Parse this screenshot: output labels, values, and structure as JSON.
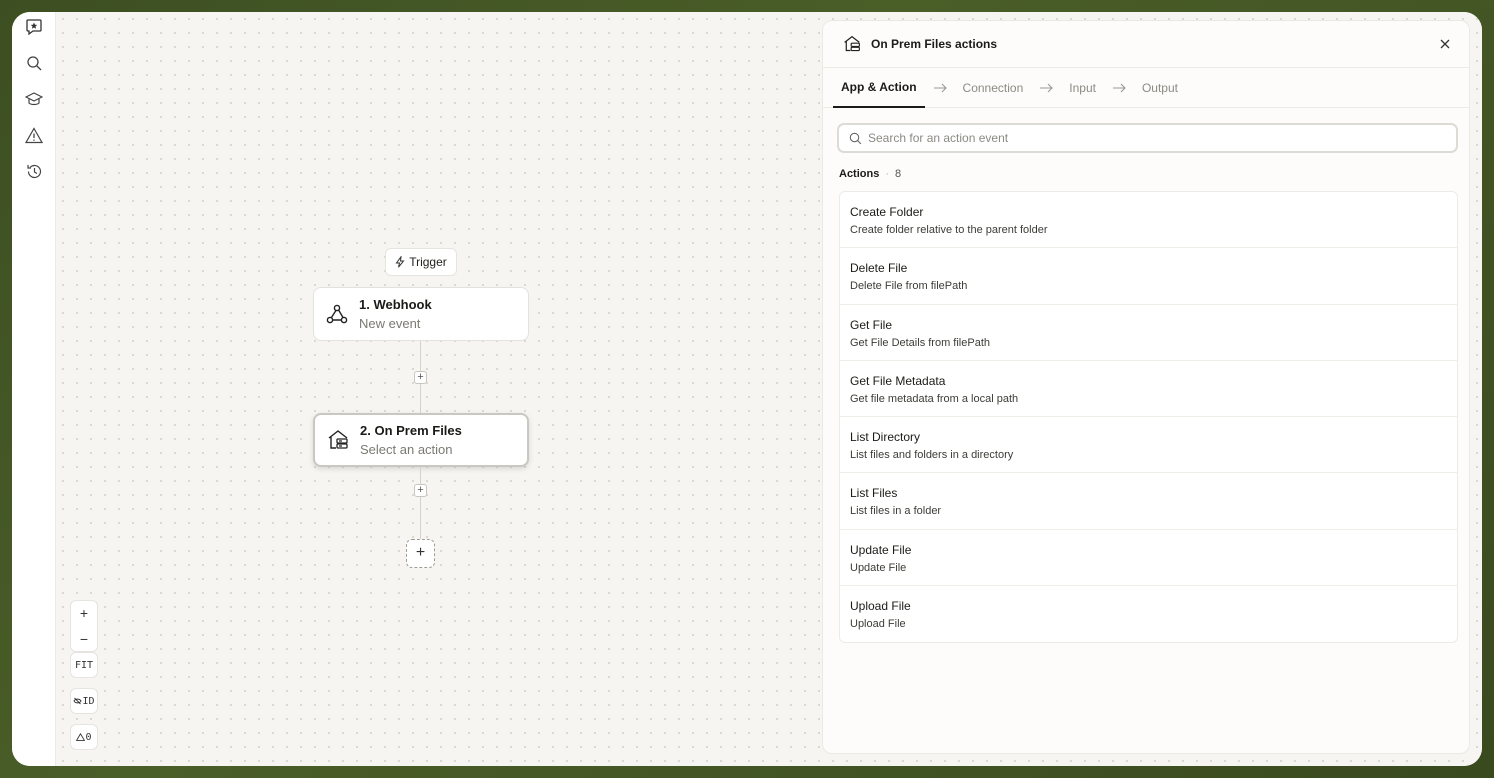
{
  "rail": {
    "items": [
      "app-logo-icon",
      "search-icon",
      "learn-icon",
      "alert-icon",
      "history-icon"
    ]
  },
  "canvas": {
    "trigger_label": "Trigger",
    "nodes": [
      {
        "title": "1. Webhook",
        "subtitle": "New event"
      },
      {
        "title": "2. On Prem Files",
        "subtitle": "Select an action"
      }
    ],
    "add_step": "+",
    "zoom": {
      "in": "+",
      "out": "−",
      "fit": "FIT",
      "id": "ID",
      "warnings": "0"
    }
  },
  "panel": {
    "title": "On Prem Files actions",
    "tabs": [
      "App & Action",
      "Connection",
      "Input",
      "Output"
    ],
    "search_placeholder": "Search for an action event",
    "section_label": "Actions",
    "section_count": "8",
    "actions": [
      {
        "title": "Create Folder",
        "desc": "Create folder relative to the parent folder"
      },
      {
        "title": "Delete File",
        "desc": "Delete File from filePath"
      },
      {
        "title": "Get File",
        "desc": "Get File Details from filePath"
      },
      {
        "title": "Get File Metadata",
        "desc": "Get file metadata from a local path"
      },
      {
        "title": "List Directory",
        "desc": "List files and folders in a directory"
      },
      {
        "title": "List Files",
        "desc": "List files in a folder"
      },
      {
        "title": "Update File",
        "desc": "Update File"
      },
      {
        "title": "Upload File",
        "desc": "Upload File"
      }
    ]
  }
}
